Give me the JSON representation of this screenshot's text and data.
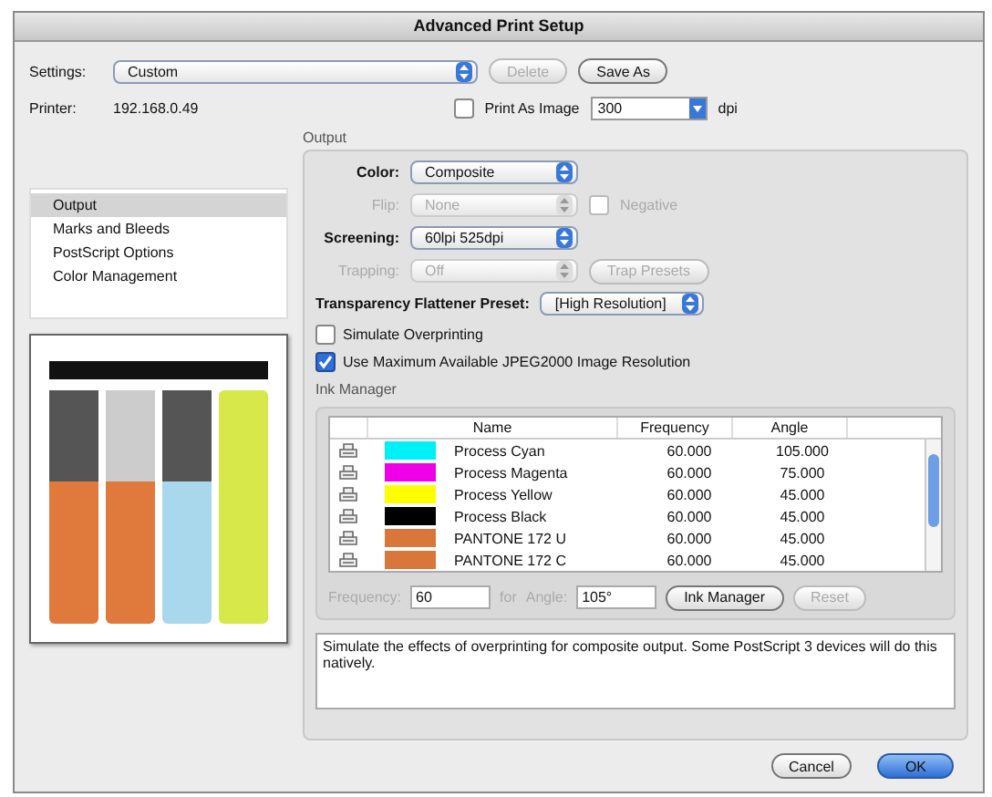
{
  "window": {
    "title": "Advanced Print Setup"
  },
  "settings": {
    "label": "Settings:",
    "value": "Custom",
    "buttons": [
      {
        "label": "Delete",
        "disabled": true
      },
      {
        "label": "Save As",
        "disabled": false
      }
    ]
  },
  "printer": {
    "label": "Printer:",
    "value": "192.168.0.49"
  },
  "print_as_image": {
    "label": "Print As Image",
    "checked": false,
    "value": "300",
    "unit": "dpi"
  },
  "sidebar": {
    "items": [
      {
        "label": "Output",
        "selected": true
      },
      {
        "label": "Marks and Bleeds",
        "selected": false
      },
      {
        "label": "PostScript Options",
        "selected": false
      },
      {
        "label": "Color Management",
        "selected": false
      }
    ]
  },
  "output": {
    "title": "Output",
    "rows": [
      {
        "label": "Color:",
        "value": "Composite",
        "disabled": false
      },
      {
        "label": "Flip:",
        "value": "None",
        "disabled": true,
        "extra": {
          "kind": "checkbox",
          "label": "Negative",
          "checked": false,
          "disabled": true
        }
      },
      {
        "label": "Screening:",
        "value": "60lpi 525dpi",
        "disabled": false
      },
      {
        "label": "Trapping:",
        "value": "Off",
        "disabled": true,
        "extra": {
          "kind": "button",
          "label": "Trap Presets",
          "disabled": true
        }
      }
    ],
    "flattener": {
      "label": "Transparency Flattener Preset:",
      "value": "[High Resolution]"
    },
    "checkboxes": [
      {
        "label": "Simulate Overprinting",
        "checked": false
      },
      {
        "label": "Use Maximum Available JPEG2000 Image Resolution",
        "checked": true
      }
    ]
  },
  "ink_manager": {
    "title": "Ink Manager",
    "columns": [
      "Name",
      "Frequency",
      "Angle"
    ],
    "rows": [
      {
        "color": "#00f0f8",
        "name": "Process Cyan",
        "frequency": "60.000",
        "angle": "105.000"
      },
      {
        "color": "#f000e8",
        "name": "Process Magenta",
        "frequency": "60.000",
        "angle": "75.000"
      },
      {
        "color": "#ffff00",
        "name": "Process Yellow",
        "frequency": "60.000",
        "angle": "45.000"
      },
      {
        "color": "#000000",
        "name": "Process Black",
        "frequency": "60.000",
        "angle": "45.000"
      },
      {
        "color": "#d9773a",
        "name": "PANTONE 172 U",
        "frequency": "60.000",
        "angle": "45.000"
      },
      {
        "color": "#d9773a",
        "name": "PANTONE 172 C",
        "frequency": "60.000",
        "angle": "45.000"
      }
    ],
    "frequency": {
      "label": "Frequency:",
      "value": "60"
    },
    "angle": {
      "for_label": "for",
      "label": "Angle:",
      "value": "105°"
    },
    "buttons": [
      {
        "label": "Ink Manager",
        "disabled": false
      },
      {
        "label": "Reset",
        "disabled": true
      }
    ]
  },
  "description": "Simulate the effects of overprinting for composite output. Some PostScript 3 devices will do this natively.",
  "footer_buttons": [
    {
      "label": "Cancel",
      "kind": "normal"
    },
    {
      "label": "OK",
      "kind": "default"
    }
  ]
}
